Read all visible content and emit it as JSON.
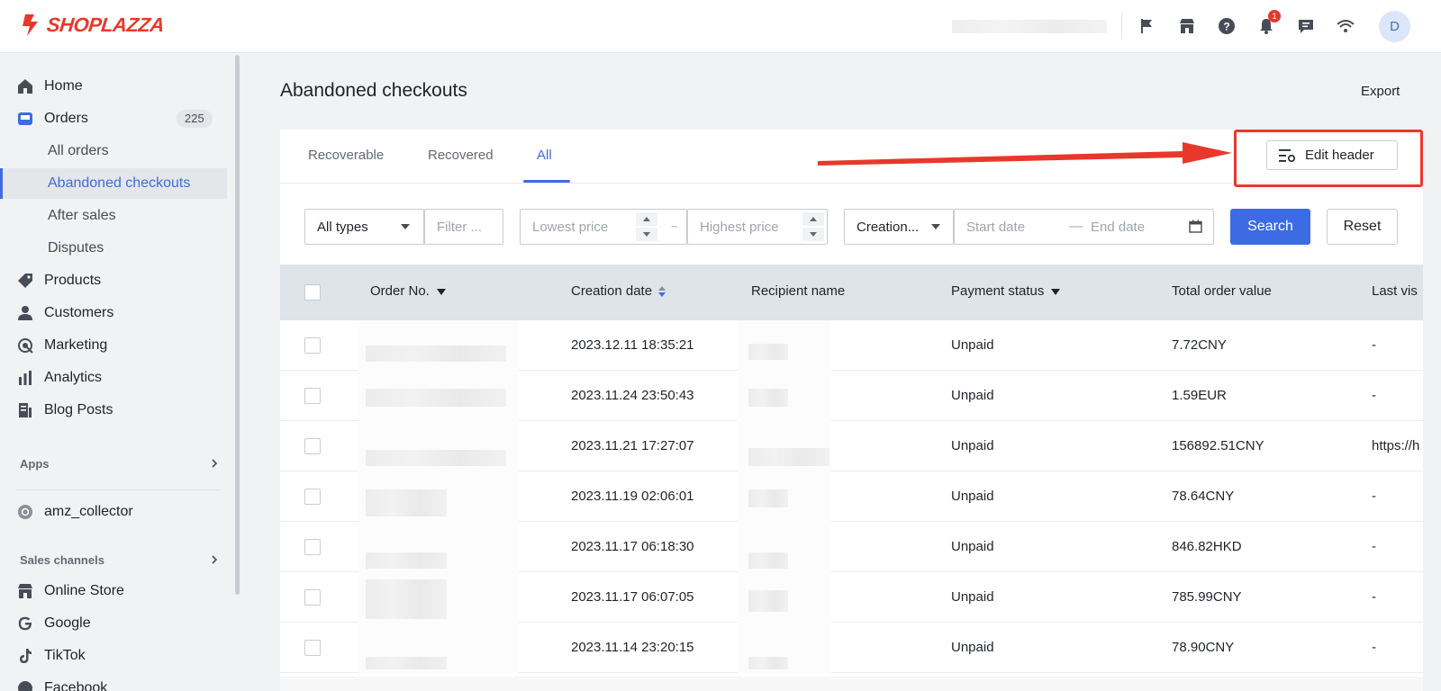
{
  "brand": {
    "name": "SHOPLAZZA",
    "color": "#e8382c"
  },
  "accent_color": "#3c6be4",
  "topbar": {
    "icons": [
      "flag-icon",
      "store-icon",
      "help-icon",
      "bell-icon",
      "chat-icon",
      "wifi-icon"
    ],
    "notification_count": "1",
    "avatar_initial": "D"
  },
  "sidebar": {
    "items": [
      {
        "label": "Home",
        "icon": "home-icon"
      },
      {
        "label": "Orders",
        "icon": "orders-icon",
        "count": "225"
      },
      {
        "label": "All orders"
      },
      {
        "label": "Abandoned checkouts",
        "active": true
      },
      {
        "label": "After sales"
      },
      {
        "label": "Disputes"
      },
      {
        "label": "Products",
        "icon": "tag-icon"
      },
      {
        "label": "Customers",
        "icon": "person-icon"
      },
      {
        "label": "Marketing",
        "icon": "marketing-icon"
      },
      {
        "label": "Analytics",
        "icon": "analytics-icon"
      },
      {
        "label": "Blog Posts",
        "icon": "blog-icon"
      }
    ],
    "apps_label": "Apps",
    "app_item": "amz_collector",
    "channels_label": "Sales channels",
    "channels": [
      "Online Store",
      "Google",
      "TikTok",
      "Facebook"
    ]
  },
  "page": {
    "title": "Abandoned checkouts",
    "export_label": "Export",
    "tabs": [
      "Recoverable",
      "Recovered",
      "All"
    ],
    "active_tab": "All",
    "edit_header_label": "Edit header"
  },
  "filters": {
    "type_value": "All types",
    "filter_placeholder": "Filter ...",
    "lowest_price_placeholder": "Lowest price",
    "price_separator": "~",
    "highest_price_placeholder": "Highest price",
    "date_type_value": "Creation...",
    "start_date_placeholder": "Start date",
    "date_separator": "—",
    "end_date_placeholder": "End date",
    "search_label": "Search",
    "reset_label": "Reset"
  },
  "table": {
    "columns": [
      "Order No.",
      "Creation date",
      "Recipient name",
      "Payment status",
      "Total order value",
      "Last vis"
    ],
    "rows": [
      {
        "date": "2023.12.11 18:35:21",
        "status": "Unpaid",
        "total": "7.72CNY",
        "last": "-"
      },
      {
        "date": "2023.11.24 23:50:43",
        "status": "Unpaid",
        "total": "1.59EUR",
        "last": "-"
      },
      {
        "date": "2023.11.21 17:27:07",
        "status": "Unpaid",
        "total": "156892.51CNY",
        "last": "https://h"
      },
      {
        "date": "2023.11.19 02:06:01",
        "status": "Unpaid",
        "total": "78.64CNY",
        "last": "-"
      },
      {
        "date": "2023.11.17 06:18:30",
        "status": "Unpaid",
        "total": "846.82HKD",
        "last": "-"
      },
      {
        "date": "2023.11.17 06:07:05",
        "status": "Unpaid",
        "total": "785.99CNY",
        "last": "-"
      },
      {
        "date": "2023.11.14 23:20:15",
        "status": "Unpaid",
        "total": "78.90CNY",
        "last": "-"
      }
    ]
  }
}
